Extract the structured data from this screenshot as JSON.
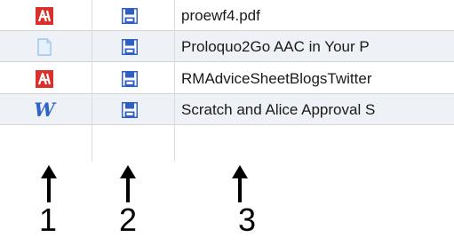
{
  "files": [
    {
      "type_icon": "acrobat-pdf-icon",
      "save_icon": "floppy-disk-icon",
      "name": "proewf4.pdf"
    },
    {
      "type_icon": "generic-document-icon",
      "save_icon": "floppy-disk-icon",
      "name": "Proloquo2Go AAC in Your P"
    },
    {
      "type_icon": "acrobat-pdf-icon",
      "save_icon": "floppy-disk-icon",
      "name": "RMAdviceSheetBlogsTwitter"
    },
    {
      "type_icon": "word-document-icon",
      "save_icon": "floppy-disk-icon",
      "name": "Scratch and Alice Approval S"
    }
  ],
  "word_icon_letter": "W",
  "callouts": [
    "1",
    "2",
    "3"
  ],
  "colors": {
    "pdf_red": "#d9302c",
    "floppy_blue": "#2e5fc9",
    "word_blue": "#2c64c8",
    "row_stripe": "#eef1f6",
    "doc_blue": "#9ec4ea"
  }
}
